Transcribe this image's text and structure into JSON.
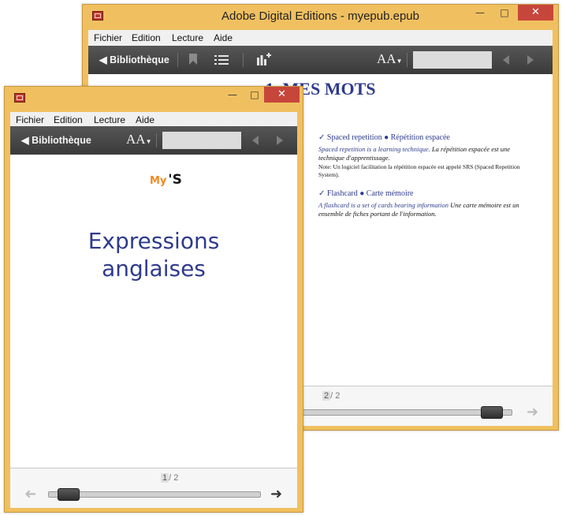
{
  "back_window": {
    "title": "Adobe Digital Editions - myepub.epub",
    "menu": [
      "Fichier",
      "Edition",
      "Lecture",
      "Aide"
    ],
    "toolbar": {
      "library": "◀ Bibliothèque",
      "font_size": "AA"
    },
    "content": {
      "heading": "1. MES MOTS",
      "entries": [
        {
          "term": "✓ Spaced repetition ● Répétition espacée",
          "english": "Spaced repetition is a learning technique.",
          "french": " La répétition espacée est une technique d'apprentissage.",
          "note": "Note: Un logiciel facilitation la répétition espacée est appelé SRS (Spaced Repetition System)."
        },
        {
          "term": "✓ Flashcard ● Carte mémoire",
          "english": "A flashcard is a set of cards bearing information",
          "french": " Une carte mémoire est un ensemble de fiches portant de l'information.",
          "note": ""
        }
      ]
    },
    "pagination": {
      "current": "2",
      "total": "/ 2"
    },
    "progress": 0.95
  },
  "front_window": {
    "menu": [
      "Fichier",
      "Edition",
      "Lecture",
      "Aide"
    ],
    "toolbar": {
      "library": "◀ Bibliothèque",
      "font_size": "AA"
    },
    "content": {
      "logo_my": "My",
      "logo_s": "'S",
      "title_line1": "Expressions",
      "title_line2": "anglaises"
    },
    "pagination": {
      "current": "1",
      "total": "/ 2"
    },
    "progress": 0.05
  },
  "colors": {
    "frame": "#f0c060",
    "toolbar": "#444444",
    "close": "#c7463b",
    "heading_blue": "#2e3b8c",
    "logo_orange": "#f08a24"
  },
  "icons": [
    "app-icon",
    "minimize-icon",
    "maximize-icon",
    "close-icon",
    "bookmark-icon",
    "list-icon",
    "chart-add-icon",
    "prev-icon",
    "next-icon",
    "arrow-left-icon",
    "arrow-right-icon"
  ]
}
